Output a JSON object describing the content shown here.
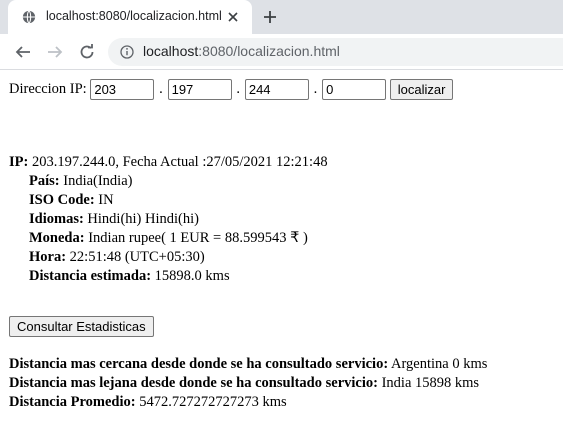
{
  "browser": {
    "tab_title": "localhost:8080/localizacion.html",
    "url_host": "localhost",
    "url_path": ":8080/localizacion.html"
  },
  "form": {
    "label": "Direccion IP:",
    "octets": [
      "203",
      "197",
      "244",
      "0"
    ],
    "separator": ".",
    "submit_label": "localizar"
  },
  "result": {
    "ip_label": "IP:",
    "ip_value": " 203.197.244.0, Fecha Actual :27/05/2021 12:21:48",
    "fields": [
      {
        "label": "País:",
        "value": " India(India)"
      },
      {
        "label": "ISO Code:",
        "value": " IN"
      },
      {
        "label": "Idiomas:",
        "value": " Hindi(hi) Hindi(hi)"
      },
      {
        "label": "Moneda:",
        "value": " Indian rupee( 1 EUR = 88.599543 ₹ )"
      },
      {
        "label": "Hora:",
        "value": " 22:51:48 (UTC+05:30)"
      },
      {
        "label": "Distancia estimada:",
        "value": " 15898.0 kms"
      }
    ]
  },
  "stats_button_label": "Consultar Estadisticas",
  "stats": [
    {
      "label": "Distancia mas cercana desde donde se ha consultado servicio:",
      "value": " Argentina 0 kms"
    },
    {
      "label": "Distancia mas lejana desde donde se ha consultado servicio:",
      "value": " India 15898 kms"
    },
    {
      "label": "Distancia Promedio:",
      "value": " 5472.727272727273 kms"
    }
  ]
}
